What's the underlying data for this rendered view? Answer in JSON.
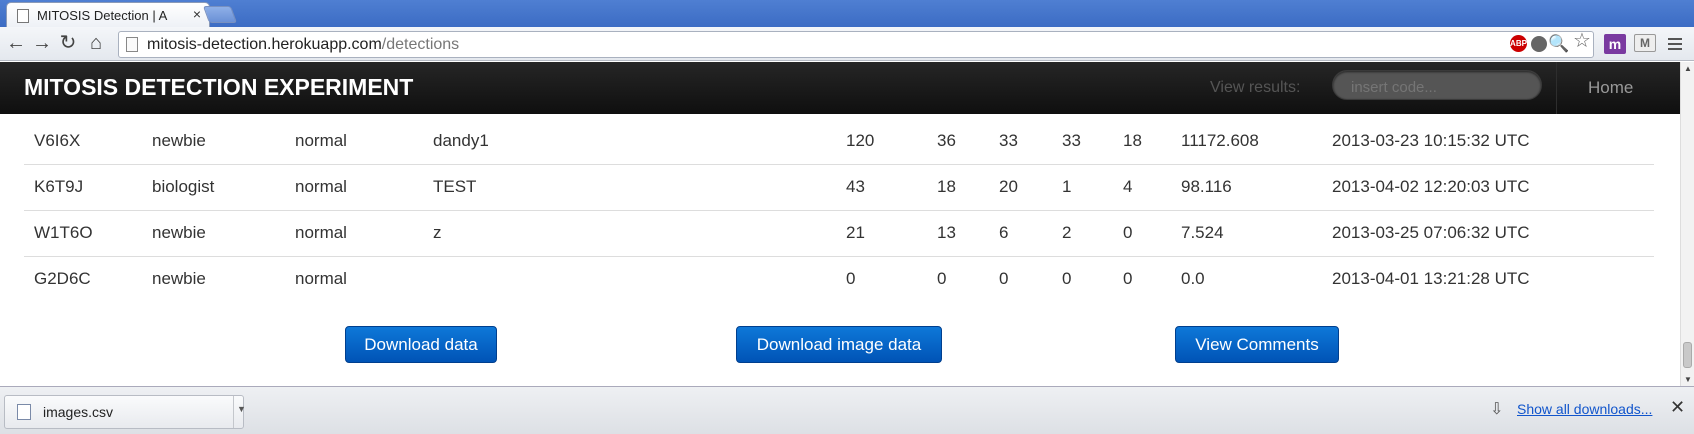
{
  "browser": {
    "tab_title": "MITOSIS Detection | A",
    "tab_close": "×",
    "url_host": "mitosis-detection.herokuapp.com",
    "url_path": "/detections",
    "back_glyph": "←",
    "forward_glyph": "→",
    "reload_glyph": "↻",
    "home_glyph": "⌂",
    "ext_abp": "ABP",
    "ext_m": "m",
    "ext_mail": "M",
    "zoom_glyph": "🔍",
    "star_glyph": "☆"
  },
  "navbar": {
    "brand": "MITOSIS DETECTION EXPERIMENT",
    "view_results_label": "View results:",
    "search_placeholder": "insert code...",
    "home_link": "Home"
  },
  "table": {
    "rows": [
      [
        "V6I6X",
        "newbie",
        "normal",
        "dandy1",
        "120",
        "36",
        "33",
        "33",
        "18",
        "11172.608",
        "2013-03-23 10:15:32 UTC"
      ],
      [
        "K6T9J",
        "biologist",
        "normal",
        "TEST",
        "43",
        "18",
        "20",
        "1",
        "4",
        "98.116",
        "2013-04-02 12:20:03 UTC"
      ],
      [
        "W1T6O",
        "newbie",
        "normal",
        "z",
        "21",
        "13",
        "6",
        "2",
        "0",
        "7.524",
        "2013-03-25 07:06:32 UTC"
      ],
      [
        "G2D6C",
        "newbie",
        "normal",
        "",
        "0",
        "0",
        "0",
        "0",
        "0",
        "0.0",
        "2013-04-01 13:21:28 UTC"
      ]
    ]
  },
  "actions": {
    "download_data": "Download data",
    "download_image_data": "Download image data",
    "view_comments": "View Comments"
  },
  "downloads": {
    "file_name": "images.csv",
    "show_all": "Show all downloads...",
    "close_glyph": "✕",
    "arrow_glyph": "⇩",
    "caret_glyph": "▼"
  },
  "colors": {
    "tab_strip": "#3c6cc4",
    "navbar": "#1a1a1a",
    "button": "#0062c8",
    "link": "#1155cc"
  }
}
